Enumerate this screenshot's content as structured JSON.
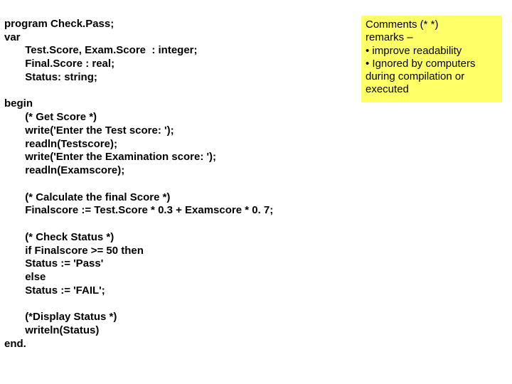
{
  "code": {
    "l1": "program Check.Pass;",
    "l2": "var",
    "l3": "Test.Score, Exam.Score  : integer;",
    "l4": "Final.Score : real;",
    "l5": "Status: string;",
    "l6": "begin",
    "l7": "(* Get Score *)",
    "l8": "write('Enter the Test score: ');",
    "l9": "readln(Testscore);",
    "l10": "write('Enter the Examination score: ');",
    "l11": "readln(Examscore);",
    "l12": "(* Calculate the final Score *)",
    "l13": "Finalscore := Test.Score * 0.3 + Examscore * 0. 7;",
    "l14": "(* Check Status *)",
    "l15": "if Finalscore >= 50 then",
    "l16": "Status := 'Pass'",
    "l17": "else",
    "l18": "Status := 'FAIL';",
    "l19": "(*Display Status *)",
    "l20": "writeln(Status)",
    "l21": "end."
  },
  "note": {
    "title": "Comments (*       *)",
    "line1": " remarks –",
    "line2": "• improve readability",
    "line3": "• Ignored by computers",
    "line4": "during compilation or",
    "line5": "executed"
  }
}
